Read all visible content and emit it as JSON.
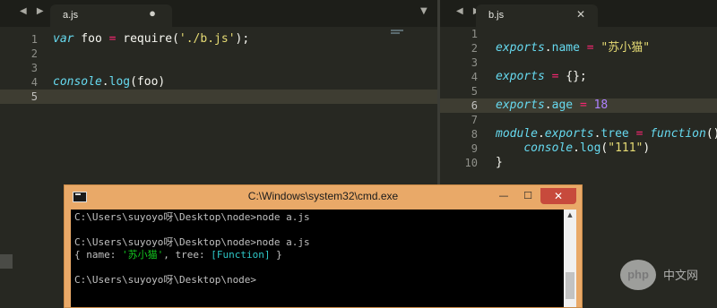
{
  "left_pane": {
    "tab": {
      "title": "a.js",
      "dirty_marker": "●"
    },
    "nav_arrows": "◀ ▶",
    "tab_menu": "▼",
    "lines": [
      {
        "n": "1",
        "tokens": [
          {
            "t": "var",
            "c": "kw"
          },
          {
            "t": " foo "
          },
          {
            "t": "=",
            "c": "op"
          },
          {
            "t": " require("
          },
          {
            "t": "'./b.js'",
            "c": "str"
          },
          {
            "t": ");"
          }
        ]
      },
      {
        "n": "2",
        "tokens": []
      },
      {
        "n": "3",
        "tokens": []
      },
      {
        "n": "4",
        "tokens": [
          {
            "t": "console",
            "c": "kw"
          },
          {
            "t": "."
          },
          {
            "t": "log",
            "c": "fn"
          },
          {
            "t": "(foo)"
          }
        ]
      },
      {
        "n": "5",
        "active": true,
        "tokens": []
      }
    ]
  },
  "right_pane": {
    "tab": {
      "title": "b.js",
      "close": "✕"
    },
    "nav_arrows": "◀ ▶",
    "lines": [
      {
        "n": "1",
        "tokens": []
      },
      {
        "n": "2",
        "tokens": [
          {
            "t": "exports",
            "c": "kw"
          },
          {
            "t": "."
          },
          {
            "t": "name",
            "c": "fn"
          },
          {
            "t": " "
          },
          {
            "t": "=",
            "c": "op"
          },
          {
            "t": " "
          },
          {
            "t": "\"苏小猫\"",
            "c": "str"
          }
        ]
      },
      {
        "n": "3",
        "tokens": []
      },
      {
        "n": "4",
        "tokens": [
          {
            "t": "exports",
            "c": "kw"
          },
          {
            "t": " "
          },
          {
            "t": "=",
            "c": "op"
          },
          {
            "t": " {};"
          }
        ]
      },
      {
        "n": "5",
        "tokens": []
      },
      {
        "n": "6",
        "active": true,
        "tokens": [
          {
            "t": "exports",
            "c": "kw"
          },
          {
            "t": "."
          },
          {
            "t": "age",
            "c": "fn"
          },
          {
            "t": " "
          },
          {
            "t": "=",
            "c": "op"
          },
          {
            "t": " "
          },
          {
            "t": "18",
            "c": "num"
          }
        ]
      },
      {
        "n": "7",
        "tokens": []
      },
      {
        "n": "8",
        "tokens": [
          {
            "t": "module",
            "c": "kw"
          },
          {
            "t": "."
          },
          {
            "t": "exports",
            "c": "kw"
          },
          {
            "t": "."
          },
          {
            "t": "tree",
            "c": "fn"
          },
          {
            "t": " "
          },
          {
            "t": "=",
            "c": "op"
          },
          {
            "t": " "
          },
          {
            "t": "function",
            "c": "kw"
          },
          {
            "t": "(){"
          }
        ]
      },
      {
        "n": "9",
        "tokens": [
          {
            "t": "    "
          },
          {
            "t": "console",
            "c": "kw"
          },
          {
            "t": "."
          },
          {
            "t": "log",
            "c": "fn"
          },
          {
            "t": "("
          },
          {
            "t": "\"111\"",
            "c": "str"
          },
          {
            "t": ")"
          }
        ]
      },
      {
        "n": "10",
        "tokens": [
          {
            "t": "}"
          }
        ]
      }
    ]
  },
  "cmd": {
    "title": "C:\\Windows\\system32\\cmd.exe",
    "min_label": "—",
    "max_label": "☐",
    "close_label": "✕",
    "scroll_up": "▲",
    "lines": [
      {
        "segs": [
          {
            "t": "C:\\Users\\suyoyo呀\\Desktop\\node>node a.js"
          }
        ]
      },
      {
        "segs": []
      },
      {
        "segs": [
          {
            "t": "C:\\Users\\suyoyo呀\\Desktop\\node>node a.js"
          }
        ]
      },
      {
        "segs": [
          {
            "t": "{ name: "
          },
          {
            "t": "'苏小猫'",
            "c": "cgreen"
          },
          {
            "t": ", tree: "
          },
          {
            "t": "[Function]",
            "c": "ccyan"
          },
          {
            "t": " }"
          }
        ]
      },
      {
        "segs": []
      },
      {
        "segs": [
          {
            "t": "C:\\Users\\suyoyo呀\\Desktop\\node>"
          }
        ]
      }
    ]
  },
  "watermark": {
    "logo": "php",
    "text": "中文网"
  }
}
